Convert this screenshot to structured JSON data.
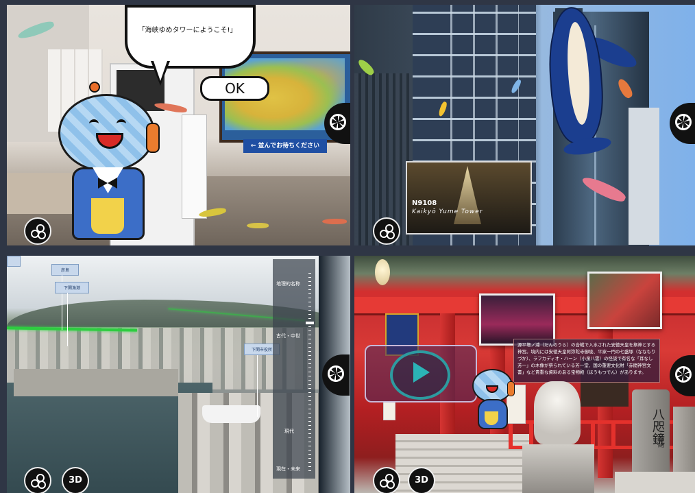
{
  "panel1": {
    "speech_bubble_text": "「海峡ゆめタワーにようこそ!」",
    "ok_button_label": "OK",
    "queue_sign_text": "← 並んでお待ちください"
  },
  "panel2": {
    "video_code": "N9108",
    "video_title": "Kaikyō Yume Tower",
    "video_subtitle": ""
  },
  "panel3": {
    "map_labels": [
      "彦島",
      "下関漁港"
    ],
    "right_label": "下関市役所",
    "ruler_title": "地理的名称",
    "ruler_marks": [
      "古代・中世",
      "現代",
      "現在・未来"
    ]
  },
  "panel4": {
    "info_text": "源平壇ノ浦（だんのうら）の合戦で入水された安徳天皇を祭神とする神宮。境内には安徳天皇阿弥陀寺御陵、平家一門の七盛塚（ななもりづか）、ラフカディオ・ハーン（小泉八雲）の怪談で有名な「耳なし芳一」の木像が祭られている芳一堂、国の重要文化財「赤間神宮文書」など貴重な資料のある宝物殿（ほうもつでん）があります。",
    "stone_text": "八咫鏡",
    "stone_subtext": "奉納"
  },
  "controls": {
    "three_d_label": "3D"
  }
}
